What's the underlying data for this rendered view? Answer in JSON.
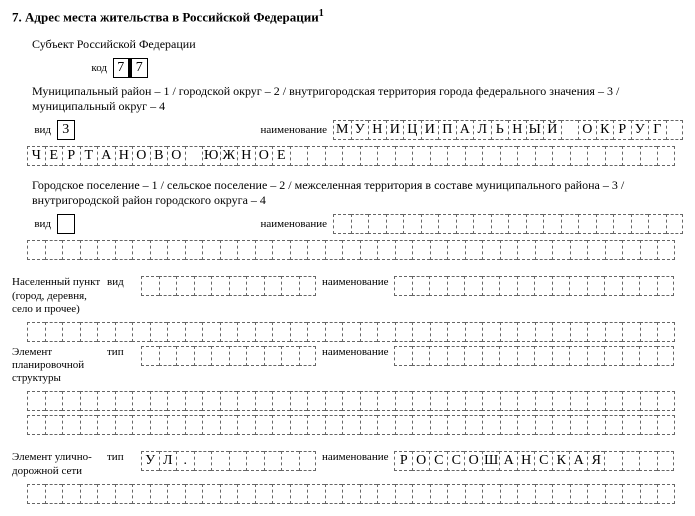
{
  "title": "7. Адрес места жительства в Российской Федерации",
  "title_sup": "1",
  "subject_label": "Субъект Российской Федерации",
  "code_label": "код",
  "code_value": "77",
  "mun_row_text": "Муниципальный район – 1 / городской округ – 2 / внутригородская территория города федерального значения – 3 / муниципальный округ – 4",
  "vid_label": "вид",
  "name_label": "наименование",
  "tip_label": "тип",
  "mun_vid": "3",
  "mun_name_l1": "МУНИЦИПАЛЬНЫЙ ОКРУГ",
  "mun_name_l2": "ЧЕРТАНОВО ЮЖНОЕ",
  "settle_text": "Городское поселение – 1 / сельское поселение – 2 / межселенная территория в составе муниципального района – 3 / внутригородской район городского округа – 4",
  "settle_vid": "",
  "settle_name_l1": "",
  "settle_name_l2": "",
  "np_label": "Населенный пункт (город, деревня, село и прочее)",
  "np_vid": "",
  "np_name": "",
  "np_l2": "",
  "eps_label": "Элемент планировочной структуры",
  "eps_tip": "",
  "eps_name": "",
  "eps_l2": "",
  "eps_l3": "",
  "street_label": "Элемент улично-дорожной сети",
  "street_tip": "УЛ.",
  "street_name": "РОССОШАНСКАЯ",
  "street_l2": ""
}
